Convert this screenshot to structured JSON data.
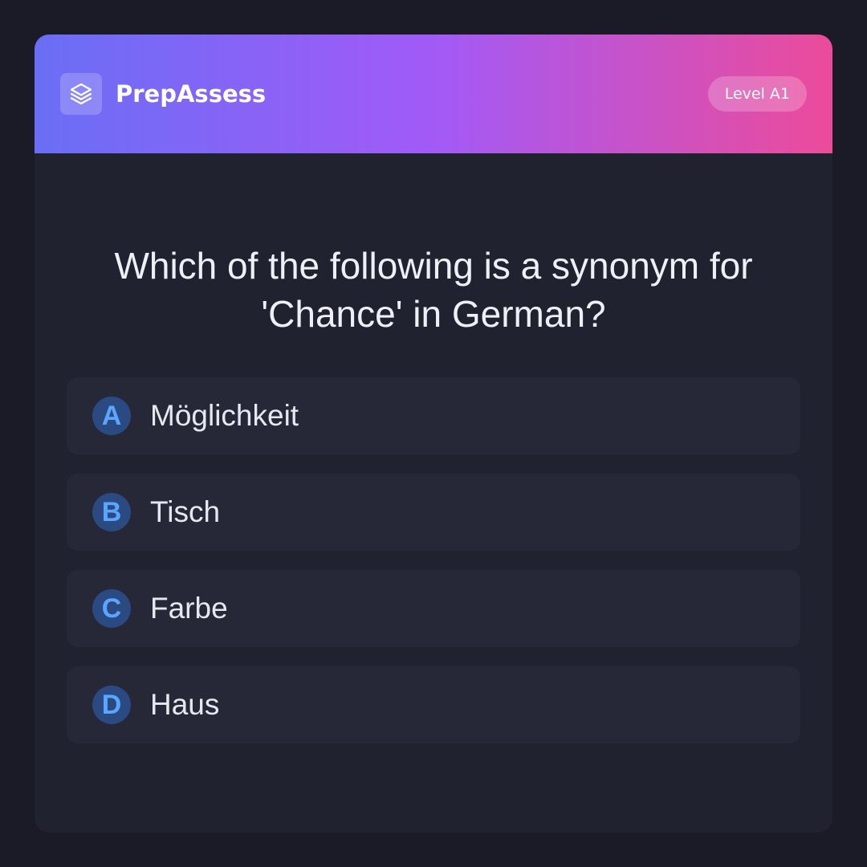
{
  "header": {
    "logo_icon": "layers-icon",
    "brand": "PrepAssess",
    "level": "Level A1"
  },
  "question": {
    "text": "Which of the following is a synonym for 'Chance' in German?"
  },
  "options": [
    {
      "letter": "A",
      "text": "Möglichkeit"
    },
    {
      "letter": "B",
      "text": "Tisch"
    },
    {
      "letter": "C",
      "text": "Farbe"
    },
    {
      "letter": "D",
      "text": "Haus"
    }
  ],
  "colors": {
    "background": "#1a1b26",
    "card": "#202230",
    "option": "#262837",
    "accent": "#5aa6ff",
    "gradient_start": "#6a6ef5",
    "gradient_mid": "#a25af7",
    "gradient_end": "#ec4b9a"
  }
}
